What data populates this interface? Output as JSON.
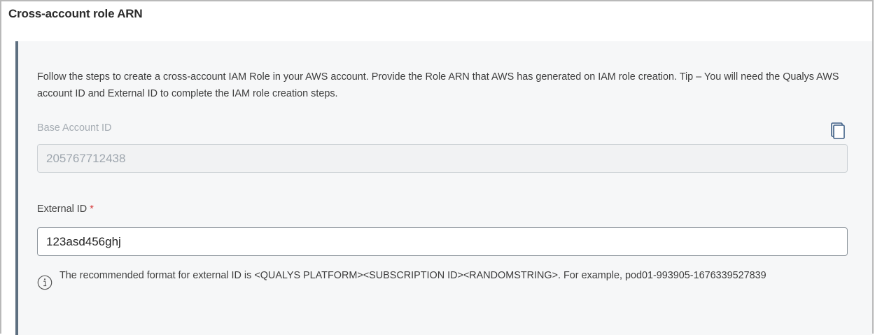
{
  "section": {
    "title": "Cross-account role ARN"
  },
  "panel": {
    "description": "Follow the steps to create a cross-account IAM Role in your AWS account. Provide the Role ARN that AWS has generated on IAM role creation. Tip – You will need the Qualys AWS account ID and External ID to complete the IAM role creation steps.",
    "base_account": {
      "label": "Base Account ID",
      "value": "205767712438"
    },
    "external_id": {
      "label": "External ID",
      "required_marker": "*",
      "value": "123asd456ghj"
    },
    "hint": {
      "text": "The recommended format for external ID is <QUALYS PLATFORM><SUBSCRIPTION ID><RANDOMSTRING>. For example, pod01-993905-1676339527839"
    }
  },
  "icons": {
    "copy": "copy-icon",
    "info": "info-icon"
  },
  "colors": {
    "panel_accent": "#5d6f80",
    "required": "#d63b3b"
  }
}
